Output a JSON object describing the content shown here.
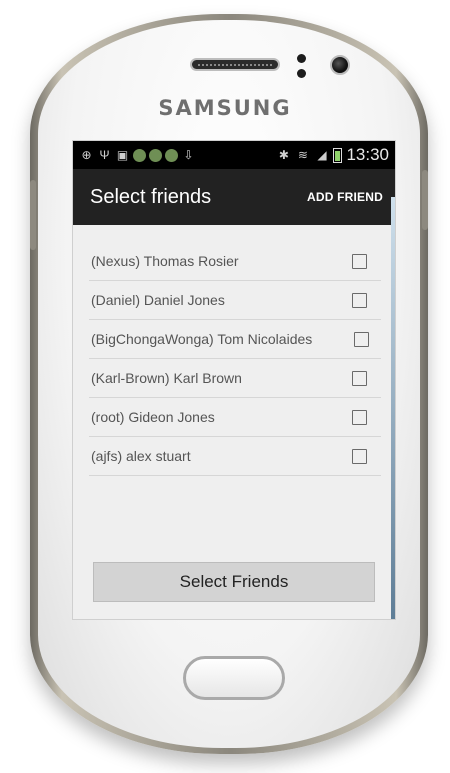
{
  "device": {
    "brand": "SAMSUNG"
  },
  "statusbar": {
    "icons": [
      "plus-icon",
      "usb-icon",
      "image-icon",
      "location-icon",
      "location-icon",
      "location-icon",
      "download-icon",
      "bluetooth-icon",
      "wifi-icon",
      "signal-icon",
      "battery-icon"
    ],
    "time": "13:30"
  },
  "actionbar": {
    "title": "Select friends",
    "action_label": "ADD FRIEND"
  },
  "friends": [
    {
      "label": "(Nexus) Thomas Rosier",
      "checked": false
    },
    {
      "label": "(Daniel) Daniel Jones",
      "checked": false
    },
    {
      "label": "(BigChongaWonga) Tom Nicolaides",
      "checked": false
    },
    {
      "label": "(Karl-Brown) Karl Brown",
      "checked": false
    },
    {
      "label": "(root) Gideon Jones",
      "checked": false
    },
    {
      "label": "(ajfs) alex stuart",
      "checked": false
    }
  ],
  "footer": {
    "button_label": "Select Friends"
  },
  "colors": {
    "actionbar_bg": "#222222",
    "statusbar_bg": "#000000",
    "screen_bg": "#efefef",
    "button_bg": "#d3d3d3"
  }
}
